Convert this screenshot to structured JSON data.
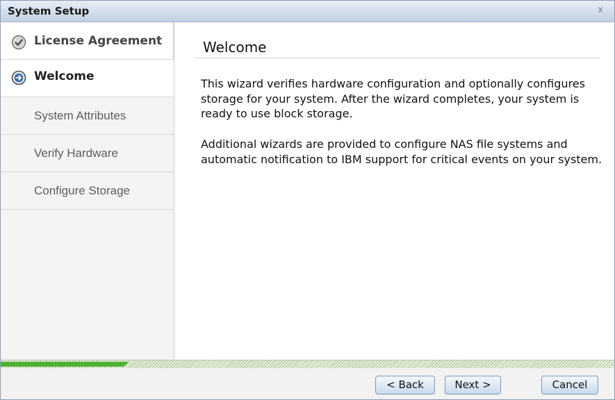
{
  "window": {
    "title": "System Setup",
    "close_label": "x"
  },
  "sidebar": {
    "steps": [
      {
        "label": "License Agreement",
        "state": "done",
        "icon": "checkmark-circle-icon"
      },
      {
        "label": "Welcome",
        "state": "current",
        "icon": "arrow-right-circle-icon"
      },
      {
        "label": "System Attributes",
        "state": "pending"
      },
      {
        "label": "Verify Hardware",
        "state": "pending"
      },
      {
        "label": "Configure Storage",
        "state": "pending"
      }
    ]
  },
  "main": {
    "heading": "Welcome",
    "paragraphs": [
      "This wizard verifies hardware configuration and optionally configures storage for your system. After the wizard completes, your system is ready to use block storage.",
      "Additional wizards are provided to configure NAS file systems and automatic notification to IBM support for critical events on your system."
    ]
  },
  "progress": {
    "fraction": 0.21
  },
  "buttons": {
    "back": "< Back",
    "next": "Next >",
    "cancel": "Cancel"
  },
  "colors": {
    "progress_fill": "#4fb134",
    "titlebar": "#c4d1e2",
    "button_border": "#7d98b8"
  }
}
